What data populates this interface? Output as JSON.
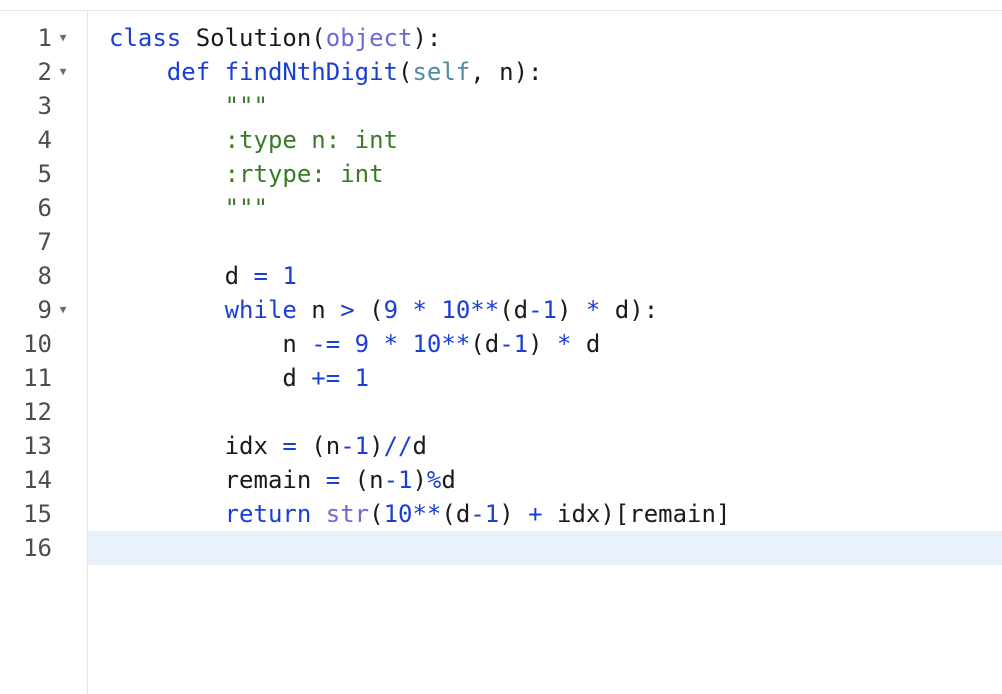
{
  "editor": {
    "language": "python",
    "active_line": 16,
    "fold_icon": "triangle-down-icon",
    "fold_lines": [
      1,
      2,
      9
    ],
    "lines": [
      {
        "number": "1",
        "tokens": [
          {
            "t": "kw",
            "v": "class"
          },
          {
            "t": "tx",
            "v": " Solution("
          },
          {
            "t": "bi",
            "v": "object"
          },
          {
            "t": "tx",
            "v": "):"
          }
        ]
      },
      {
        "number": "2",
        "tokens": [
          {
            "t": "tx",
            "v": "    "
          },
          {
            "t": "kw",
            "v": "def"
          },
          {
            "t": "tx",
            "v": " "
          },
          {
            "t": "kw",
            "v": "findNthDigit"
          },
          {
            "t": "tx",
            "v": "("
          },
          {
            "t": "self",
            "v": "self"
          },
          {
            "t": "tx",
            "v": ", n):"
          }
        ]
      },
      {
        "number": "3",
        "tokens": [
          {
            "t": "tx",
            "v": "        "
          },
          {
            "t": "str",
            "v": "\"\"\""
          }
        ]
      },
      {
        "number": "4",
        "tokens": [
          {
            "t": "tx",
            "v": "        "
          },
          {
            "t": "str",
            "v": ":type n: int"
          }
        ]
      },
      {
        "number": "5",
        "tokens": [
          {
            "t": "tx",
            "v": "        "
          },
          {
            "t": "str",
            "v": ":rtype: int"
          }
        ]
      },
      {
        "number": "6",
        "tokens": [
          {
            "t": "tx",
            "v": "        "
          },
          {
            "t": "str",
            "v": "\"\"\""
          }
        ]
      },
      {
        "number": "7",
        "tokens": []
      },
      {
        "number": "8",
        "tokens": [
          {
            "t": "tx",
            "v": "        d "
          },
          {
            "t": "op",
            "v": "="
          },
          {
            "t": "tx",
            "v": " "
          },
          {
            "t": "num",
            "v": "1"
          }
        ]
      },
      {
        "number": "9",
        "tokens": [
          {
            "t": "tx",
            "v": "        "
          },
          {
            "t": "kw",
            "v": "while"
          },
          {
            "t": "tx",
            "v": " n "
          },
          {
            "t": "op",
            "v": ">"
          },
          {
            "t": "tx",
            "v": " ("
          },
          {
            "t": "num",
            "v": "9"
          },
          {
            "t": "tx",
            "v": " "
          },
          {
            "t": "op",
            "v": "*"
          },
          {
            "t": "tx",
            "v": " "
          },
          {
            "t": "num",
            "v": "10"
          },
          {
            "t": "op",
            "v": "**"
          },
          {
            "t": "tx",
            "v": "(d"
          },
          {
            "t": "op",
            "v": "-"
          },
          {
            "t": "num",
            "v": "1"
          },
          {
            "t": "tx",
            "v": ") "
          },
          {
            "t": "op",
            "v": "*"
          },
          {
            "t": "tx",
            "v": " d):"
          }
        ]
      },
      {
        "number": "10",
        "tokens": [
          {
            "t": "tx",
            "v": "            n "
          },
          {
            "t": "op",
            "v": "-="
          },
          {
            "t": "tx",
            "v": " "
          },
          {
            "t": "num",
            "v": "9"
          },
          {
            "t": "tx",
            "v": " "
          },
          {
            "t": "op",
            "v": "*"
          },
          {
            "t": "tx",
            "v": " "
          },
          {
            "t": "num",
            "v": "10"
          },
          {
            "t": "op",
            "v": "**"
          },
          {
            "t": "tx",
            "v": "(d"
          },
          {
            "t": "op",
            "v": "-"
          },
          {
            "t": "num",
            "v": "1"
          },
          {
            "t": "tx",
            "v": ") "
          },
          {
            "t": "op",
            "v": "*"
          },
          {
            "t": "tx",
            "v": " d"
          }
        ]
      },
      {
        "number": "11",
        "tokens": [
          {
            "t": "tx",
            "v": "            d "
          },
          {
            "t": "op",
            "v": "+="
          },
          {
            "t": "tx",
            "v": " "
          },
          {
            "t": "num",
            "v": "1"
          }
        ]
      },
      {
        "number": "12",
        "tokens": []
      },
      {
        "number": "13",
        "tokens": [
          {
            "t": "tx",
            "v": "        idx "
          },
          {
            "t": "op",
            "v": "="
          },
          {
            "t": "tx",
            "v": " (n"
          },
          {
            "t": "op",
            "v": "-"
          },
          {
            "t": "num",
            "v": "1"
          },
          {
            "t": "tx",
            "v": ")"
          },
          {
            "t": "op",
            "v": "//"
          },
          {
            "t": "tx",
            "v": "d"
          }
        ]
      },
      {
        "number": "14",
        "tokens": [
          {
            "t": "tx",
            "v": "        remain "
          },
          {
            "t": "op",
            "v": "="
          },
          {
            "t": "tx",
            "v": " (n"
          },
          {
            "t": "op",
            "v": "-"
          },
          {
            "t": "num",
            "v": "1"
          },
          {
            "t": "tx",
            "v": ")"
          },
          {
            "t": "op",
            "v": "%"
          },
          {
            "t": "tx",
            "v": "d"
          }
        ]
      },
      {
        "number": "15",
        "tokens": [
          {
            "t": "tx",
            "v": "        "
          },
          {
            "t": "kw",
            "v": "return"
          },
          {
            "t": "tx",
            "v": " "
          },
          {
            "t": "bi",
            "v": "str"
          },
          {
            "t": "tx",
            "v": "("
          },
          {
            "t": "num",
            "v": "10"
          },
          {
            "t": "op",
            "v": "**"
          },
          {
            "t": "tx",
            "v": "(d"
          },
          {
            "t": "op",
            "v": "-"
          },
          {
            "t": "num",
            "v": "1"
          },
          {
            "t": "tx",
            "v": ") "
          },
          {
            "t": "op",
            "v": "+"
          },
          {
            "t": "tx",
            "v": " idx)[remain]"
          }
        ]
      },
      {
        "number": "16",
        "tokens": []
      }
    ]
  }
}
